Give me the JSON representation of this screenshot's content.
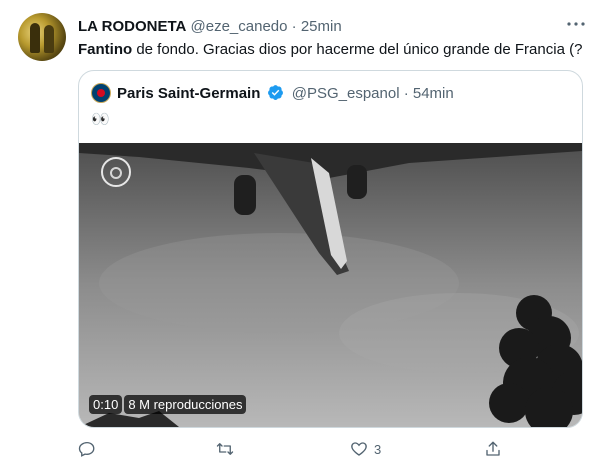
{
  "tweet": {
    "display_name": "LA RODONETA",
    "handle": "@eze_canedo",
    "separator": "·",
    "time": "25min",
    "text_bold": "Fantino",
    "text_rest": " de fondo. Gracias dios por hacerme del único grande de Francia (?"
  },
  "quoted": {
    "display_name": "Paris Saint-Germain",
    "handle": "@PSG_espanol",
    "separator": "·",
    "time": "54min",
    "text": "👀",
    "video": {
      "duration": "0:10",
      "views": "8 M reproducciones"
    }
  },
  "actions": {
    "like_count": "3"
  },
  "colors": {
    "secondary_text": "#536471",
    "verified": "#1d9bf0",
    "border": "#cfd9de"
  }
}
